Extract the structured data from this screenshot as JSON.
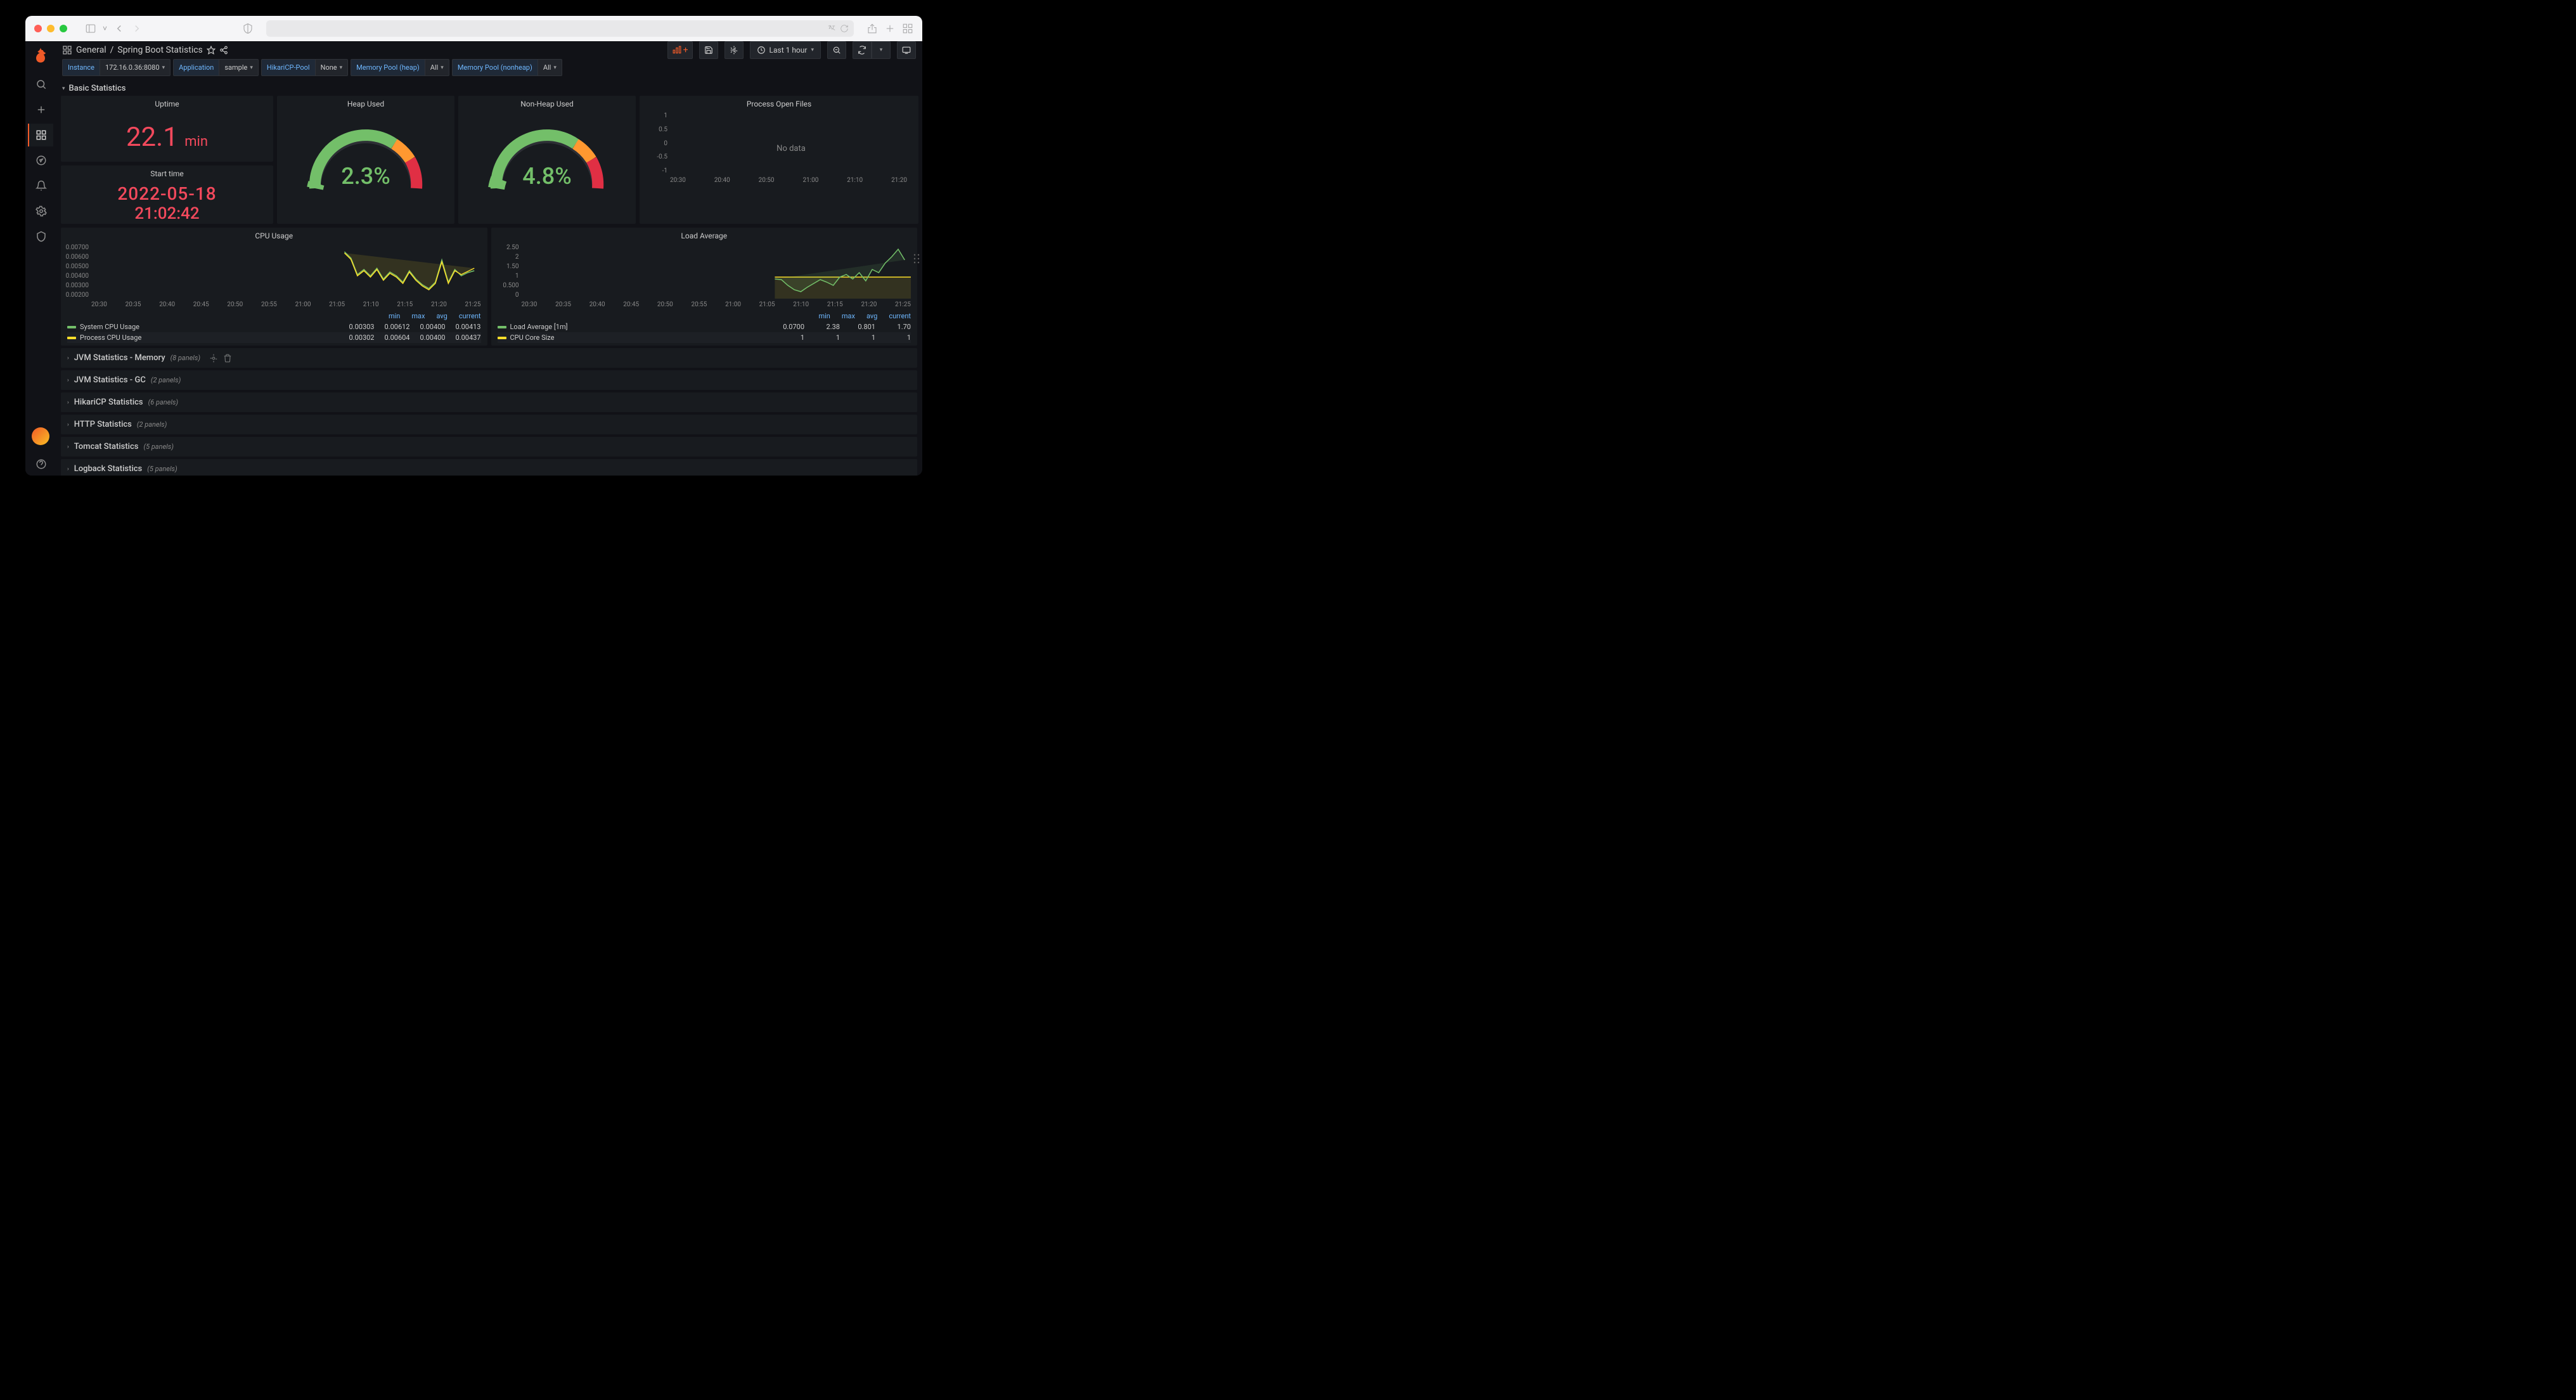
{
  "browser": {
    "url_display": ""
  },
  "breadcrumb": {
    "folder": "General",
    "sep": "/",
    "page": "Spring Boot Statistics"
  },
  "toolbar": {
    "time_label": "Last 1 hour"
  },
  "filters": [
    {
      "label": "Instance",
      "value": "172.16.0.36:8080"
    },
    {
      "label": "Application",
      "value": "sample"
    },
    {
      "label": "HikariCP-Pool",
      "value": "None"
    },
    {
      "label": "Memory Pool (heap)",
      "value": "All"
    },
    {
      "label": "Memory Pool (nonheap)",
      "value": "All"
    }
  ],
  "section": {
    "basic": "Basic Statistics"
  },
  "uptime": {
    "title": "Uptime",
    "value": "22.1",
    "unit": "min"
  },
  "starttime": {
    "title": "Start time",
    "line1": "2022-05-18",
    "line2": "21:02:42"
  },
  "heap": {
    "title": "Heap Used",
    "value": "2.3%",
    "pct": 2.3
  },
  "nonheap": {
    "title": "Non-Heap Used",
    "value": "4.8%",
    "pct": 4.8
  },
  "openfiles": {
    "title": "Process Open Files",
    "nodata": "No data",
    "yticks": [
      "1",
      "0.5",
      "0",
      "-0.5",
      "-1"
    ],
    "xticks": [
      "20:30",
      "20:40",
      "20:50",
      "21:00",
      "21:10",
      "21:20"
    ]
  },
  "cpu": {
    "title": "CPU Usage",
    "yticks": [
      "0.00700",
      "0.00600",
      "0.00500",
      "0.00400",
      "0.00300",
      "0.00200"
    ],
    "xticks": [
      "20:30",
      "20:35",
      "20:40",
      "20:45",
      "20:50",
      "20:55",
      "21:00",
      "21:05",
      "21:10",
      "21:15",
      "21:20",
      "21:25"
    ],
    "cols": [
      "min",
      "max",
      "avg",
      "current"
    ],
    "series": [
      {
        "name": "System CPU Usage",
        "color": "#73bf69",
        "vals": [
          "0.00303",
          "0.00612",
          "0.00400",
          "0.00413"
        ]
      },
      {
        "name": "Process CPU Usage",
        "color": "#fade2a",
        "vals": [
          "0.00302",
          "0.00604",
          "0.00400",
          "0.00437"
        ]
      }
    ]
  },
  "load": {
    "title": "Load Average",
    "yticks": [
      "2.50",
      "2",
      "1.50",
      "1",
      "0.500",
      "0"
    ],
    "xticks": [
      "20:30",
      "20:35",
      "20:40",
      "20:45",
      "20:50",
      "20:55",
      "21:00",
      "21:05",
      "21:10",
      "21:15",
      "21:20",
      "21:25"
    ],
    "cols": [
      "min",
      "max",
      "avg",
      "current"
    ],
    "series": [
      {
        "name": "Load Average [1m]",
        "color": "#73bf69",
        "vals": [
          "0.0700",
          "2.38",
          "0.801",
          "1.70"
        ]
      },
      {
        "name": "CPU Core Size",
        "color": "#fade2a",
        "vals": [
          "1",
          "1",
          "1",
          "1"
        ]
      }
    ]
  },
  "collapsed": [
    {
      "name": "JVM Statistics - Memory",
      "count": "(8 panels)",
      "actions": true
    },
    {
      "name": "JVM Statistics - GC",
      "count": "(2 panels)"
    },
    {
      "name": "HikariCP Statistics",
      "count": "(6 panels)"
    },
    {
      "name": "HTTP Statistics",
      "count": "(2 panels)"
    },
    {
      "name": "Tomcat Statistics",
      "count": "(5 panels)"
    },
    {
      "name": "Logback Statistics",
      "count": "(5 panels)"
    }
  ],
  "chart_data": [
    {
      "type": "line",
      "title": "Process Open Files",
      "x": [
        "20:30",
        "20:40",
        "20:50",
        "21:00",
        "21:10",
        "21:20"
      ],
      "series": [],
      "ylim": [
        -1,
        1
      ],
      "note": "No data"
    },
    {
      "type": "line",
      "title": "CPU Usage",
      "x": [
        "21:03",
        "21:05",
        "21:07",
        "21:09",
        "21:11",
        "21:13",
        "21:15",
        "21:17",
        "21:19",
        "21:21",
        "21:23",
        "21:25"
      ],
      "series": [
        {
          "name": "System CPU Usage",
          "values": [
            0.0055,
            0.006,
            0.0038,
            0.0045,
            0.004,
            0.0036,
            0.0042,
            0.0038,
            0.003,
            0.0032,
            0.0054,
            0.0041
          ]
        },
        {
          "name": "Process CPU Usage",
          "values": [
            0.0054,
            0.0059,
            0.0037,
            0.0044,
            0.004,
            0.0036,
            0.0041,
            0.0037,
            0.003,
            0.0031,
            0.0053,
            0.0044
          ]
        }
      ],
      "ylim": [
        0.002,
        0.007
      ],
      "xlabel": "",
      "ylabel": ""
    },
    {
      "type": "line",
      "title": "Load Average",
      "x": [
        "21:03",
        "21:05",
        "21:07",
        "21:09",
        "21:11",
        "21:13",
        "21:15",
        "21:17",
        "21:19",
        "21:21",
        "21:23",
        "21:25"
      ],
      "series": [
        {
          "name": "Load Average [1m]",
          "values": [
            0.9,
            0.8,
            0.5,
            0.4,
            0.6,
            0.9,
            0.7,
            1.0,
            1.1,
            0.8,
            1.5,
            2.3
          ]
        },
        {
          "name": "CPU Core Size",
          "values": [
            1,
            1,
            1,
            1,
            1,
            1,
            1,
            1,
            1,
            1,
            1,
            1
          ]
        }
      ],
      "ylim": [
        0,
        2.5
      ],
      "xlabel": "",
      "ylabel": ""
    }
  ]
}
